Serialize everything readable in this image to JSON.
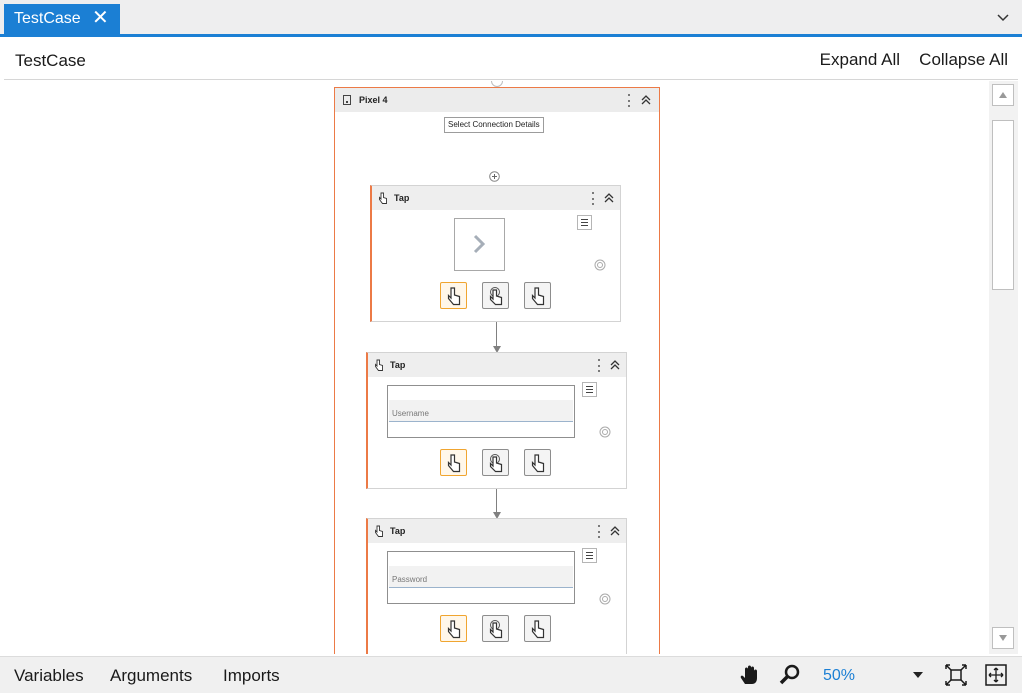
{
  "tab": {
    "label": "TestCase",
    "close_glyph": "✕"
  },
  "header": {
    "breadcrumb": "TestCase",
    "expand_all": "Expand All",
    "collapse_all": "Collapse All"
  },
  "device": {
    "title": "Pixel 4",
    "connection_button": "Select Connection Details"
  },
  "activities": [
    {
      "label": "Tap",
      "preview": "chevron-right"
    },
    {
      "label": "Tap",
      "field_placeholder": "Username"
    },
    {
      "label": "Tap",
      "field_placeholder": "Password"
    }
  ],
  "footer": {
    "variables": "Variables",
    "arguments": "Arguments",
    "imports": "Imports",
    "zoom": "50%"
  },
  "colors": {
    "accent": "#1b7fd4",
    "activity_border": "#ec7a46",
    "selected_mode": "#f0a530"
  }
}
